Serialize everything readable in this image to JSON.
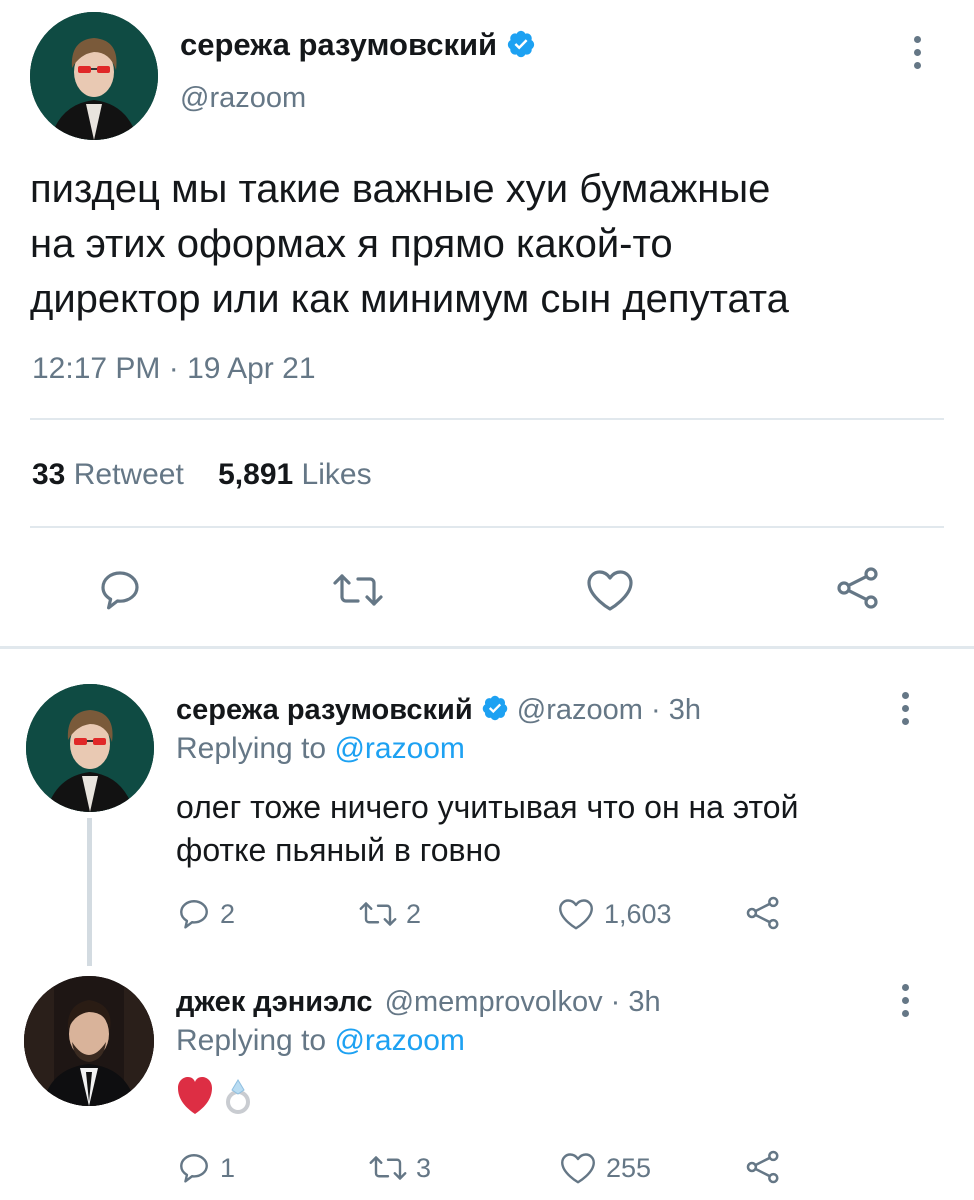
{
  "main_tweet": {
    "author_name": "сережа разумовский",
    "handle": "@razoom",
    "text_lines": [
      "пиздец мы такие важные хуи бумажные",
      "на этих оформах я прямо какой-то",
      "директор или как минимум сын депутата"
    ],
    "timestamp": "12:17 PM · 19 Apr 21",
    "retweet_count": "33",
    "retweet_label": "Retweet",
    "like_count": "5,891",
    "like_label": "Likes"
  },
  "replies": [
    {
      "author_name": "сережа разумовский",
      "handle_time": "@razoom · 3h",
      "replying_prefix": "Replying to",
      "replying_handle": "@razoom",
      "text_lines": [
        "олег тоже ничего учитывая что он на этой",
        "фотке пьяный в говно"
      ],
      "reply_count": "2",
      "retweet_count": "2",
      "like_count": "1,603"
    },
    {
      "author_name": "джек дэниэлс",
      "handle_time": "@memprovolkov · 3h",
      "replying_prefix": "Replying to",
      "replying_handle": "@razoom",
      "text": "❤️💍",
      "reply_count": "1",
      "retweet_count": "3",
      "like_count": "255"
    }
  ],
  "icons": {
    "reply": "reply-icon",
    "retweet": "retweet-icon",
    "like": "heart-icon",
    "share": "share-icon",
    "verified": "verified-badge-icon",
    "more": "more-options-icon"
  },
  "colors": {
    "accent": "#1da1f2",
    "text": "#14171a",
    "secondary": "#657786",
    "divider": "#e1e8ed"
  }
}
